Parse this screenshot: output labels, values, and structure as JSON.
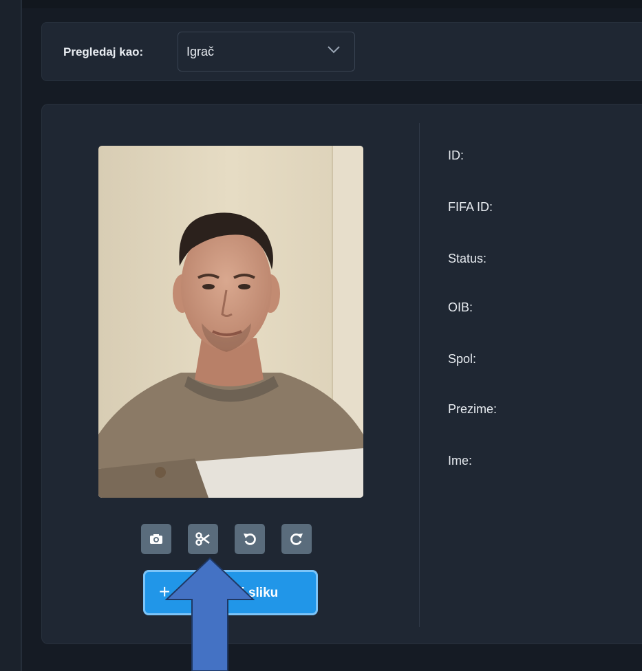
{
  "toolbar": {
    "view_as_label": "Pregledaj kao:",
    "view_as_value": "Igrač"
  },
  "player_info": {
    "fields": [
      {
        "label": "ID:"
      },
      {
        "label": "FIFA ID:"
      },
      {
        "label": "Status:"
      },
      {
        "label": "OIB:"
      },
      {
        "label": "Spol:"
      },
      {
        "label": "Prezime:"
      },
      {
        "label": "Ime:"
      }
    ]
  },
  "photo_tools": {
    "icons": [
      "camera-icon",
      "scissors-icon",
      "rotate-left-icon",
      "rotate-right-icon"
    ]
  },
  "upload": {
    "plus": "+",
    "label": "Dodaj novu / Promijeni sliku",
    "visible_label": "ri sliku"
  },
  "colors": {
    "background": "#151b24",
    "card": "#1f2733",
    "tool_button": "#5a6c7c",
    "primary": "#2196e8",
    "annotation_arrow": "#4472c4"
  }
}
